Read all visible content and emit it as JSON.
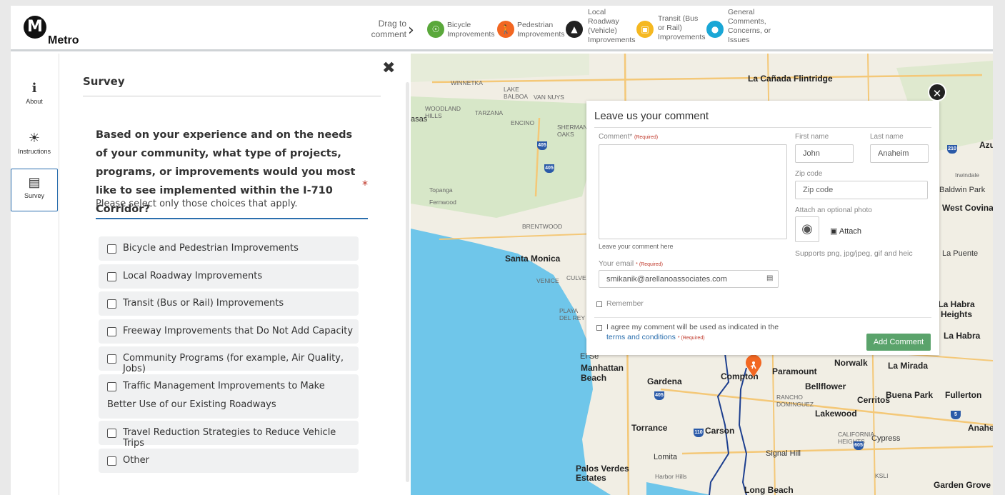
{
  "header": {
    "logo_letter": "M",
    "logo_text": "Metro",
    "drag_label": "Drag to comment",
    "categories": [
      {
        "label": "Bicycle Improvements",
        "color": "#5aa83b",
        "icon": "bicycle-icon"
      },
      {
        "label": "Pedestrian Improvements",
        "color": "#f26722",
        "icon": "pedestrian-icon"
      },
      {
        "label": "Local Roadway (Vehicle) Improvements",
        "color": "#222222",
        "icon": "car-icon"
      },
      {
        "label": "Transit (Bus or Rail) Improvements",
        "color": "#f5b820",
        "icon": "bus-icon"
      },
      {
        "label": "General Comments, Concerns, or Issues",
        "color": "#1aa7d6",
        "icon": "speech-bubble-icon"
      }
    ]
  },
  "sidebar": {
    "items": [
      {
        "label": "About",
        "icon": "info-icon"
      },
      {
        "label": "Instructions",
        "icon": "lightbulb-icon"
      },
      {
        "label": "Survey",
        "icon": "document-icon"
      }
    ]
  },
  "survey": {
    "title": "Survey",
    "question": "Based on your experience and on the needs of your community, what type of projects, programs, or improvements would you most like to see implemented within the I-710 Corridor?",
    "required_mark": "*",
    "hint": "Please select only those choices that apply.",
    "choices": [
      "Bicycle and Pedestrian Improvements",
      "Local Roadway Improvements",
      "Transit (Bus or Rail) Improvements",
      "Freeway Improvements that Do Not Add Capacity",
      "Community Programs (for example, Air Quality, Jobs)",
      "Traffic Management Improvements to Make Better Use of our Existing Roadways",
      "Travel Reduction Strategies to Reduce Vehicle Trips",
      "Other"
    ]
  },
  "comment_form": {
    "title": "Leave us your comment",
    "comment_label": "Comment*",
    "required_tag": "(Required)",
    "comment_hint": "Leave your comment here",
    "first_name_label": "First name",
    "first_name_value": "John",
    "last_name_label": "Last name",
    "last_name_value": "Anaheim",
    "zip_label": "Zip code",
    "zip_placeholder": "Zip code",
    "photo_label": "Attach an optional photo",
    "attach_label": "Attach",
    "supports_text": "Supports png, jpg/jpeg, gif and heic",
    "email_label": "Your email",
    "email_required": "* (Required)",
    "email_value": "smikanik@arellanoassociates.com",
    "remember_label": "Remember",
    "agree_text": "I agree my comment will be used as indicated in the",
    "terms_link": "terms and conditions",
    "terms_required": "* (Required)",
    "submit_label": "Add Comment"
  },
  "map": {
    "labels": [
      "La Cañada Flintridge",
      "WINNETKA",
      "LAKE BALBOA",
      "VAN NUYS",
      "WOODLAND HILLS",
      "TARZANA",
      "ENCINO",
      "SHERMAN OAKS",
      "Topanga",
      "Fernwood",
      "BRENTWOOD",
      "Santa Monica",
      "VENICE",
      "CULVER",
      "PLAYA DEL REY",
      "El Se",
      "Manhattan Beach",
      "Gardena",
      "Compton",
      "Paramount",
      "Norwalk",
      "La Mirada",
      "Bellflower",
      "Buena Park",
      "Fullerton",
      "Cerritos",
      "Lakewood",
      "Torrance",
      "Carson",
      "Cypress",
      "Anahe",
      "Lomita",
      "Signal Hill",
      "Palos Verdes Estates",
      "Harbor Hills",
      "Long Beach",
      "Garden Grove",
      "Azu",
      "Irwindale",
      "Baldwin Park",
      "West Covina",
      "La Puente",
      "La Habra Heights",
      "La Habra",
      "RANCHO DOMINGUEZ",
      "CALIFORNIA HEIGHTS",
      "KSLI",
      "asas"
    ]
  }
}
